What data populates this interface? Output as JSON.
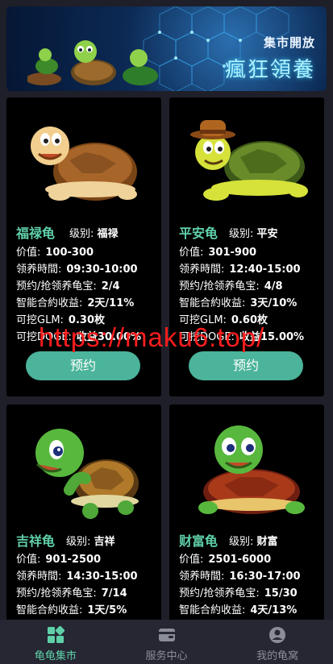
{
  "banner": {
    "subtitle": "集市開放",
    "title": "瘋狂領養"
  },
  "cards": [
    {
      "name": "福禄龟",
      "level_label": "级别:",
      "level_value": "福禄",
      "rows": [
        {
          "label": "价值:",
          "value": "100-300"
        },
        {
          "label": "领养時間:",
          "value": "09:30-10:00"
        },
        {
          "label": "预约/抢领养龟宝:",
          "value": "2/4"
        },
        {
          "label": "智能合約收益:",
          "value": "2天/11%"
        },
        {
          "label": "可挖GLM:",
          "value": "0.30枚"
        },
        {
          "label": "可挖DOGE:",
          "value": "收益30.00%"
        }
      ],
      "button": "预约",
      "icon": "brown-turtle-icon"
    },
    {
      "name": "平安龟",
      "level_label": "级别:",
      "level_value": "平安",
      "rows": [
        {
          "label": "价值:",
          "value": "301-900"
        },
        {
          "label": "领养時間:",
          "value": "12:40-15:00"
        },
        {
          "label": "预约/抢领养龟宝:",
          "value": "4/8"
        },
        {
          "label": "智能合約收益:",
          "value": "3天/10%"
        },
        {
          "label": "可挖GLM:",
          "value": "0.60枚"
        },
        {
          "label": "可挖DOGE:",
          "value": "收益15.00%"
        }
      ],
      "button": "预约",
      "icon": "hat-turtle-icon"
    },
    {
      "name": "吉祥龟",
      "level_label": "级别:",
      "level_value": "吉祥",
      "rows": [
        {
          "label": "价值:",
          "value": "901-2500"
        },
        {
          "label": "领养時間:",
          "value": "14:30-15:00"
        },
        {
          "label": "预约/抢领养龟宝:",
          "value": "7/14"
        },
        {
          "label": "智能合約收益:",
          "value": "1天/5%"
        }
      ],
      "button": "预约",
      "icon": "green-turtle-icon"
    },
    {
      "name": "财富龟",
      "level_label": "级别:",
      "level_value": "财富",
      "rows": [
        {
          "label": "价值:",
          "value": "2501-6000"
        },
        {
          "label": "领养時間:",
          "value": "16:30-17:00"
        },
        {
          "label": "预约/抢领养龟宝:",
          "value": "15/30"
        },
        {
          "label": "智能合約收益:",
          "value": "4天/13%"
        }
      ],
      "button": "预约",
      "icon": "red-shell-turtle-icon"
    }
  ],
  "watermark": "https://maku6.top/",
  "tabs": [
    {
      "label": "龟龟集市",
      "icon": "grid-icon",
      "active": true
    },
    {
      "label": "服务中心",
      "icon": "wallet-icon",
      "active": false
    },
    {
      "label": "我的龟窝",
      "icon": "user-icon",
      "active": false
    }
  ],
  "colors": {
    "accent": "#5fd0a8",
    "button": "#4bb49b",
    "watermark": "#ff1d1d",
    "card_bg": "#000000",
    "page_bg": "#1e1f29"
  }
}
